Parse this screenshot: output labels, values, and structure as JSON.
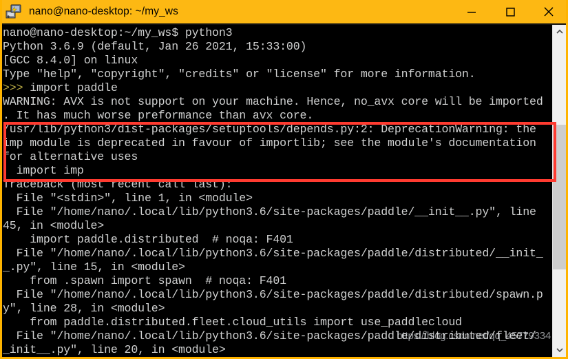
{
  "window": {
    "title": "nano@nano-desktop: ~/my_ws",
    "icon": "terminal-icon",
    "titlebar_color": "#FDB813",
    "border_color": "#FFB400",
    "background_color": "#000000",
    "text_color": "#cfd0d0",
    "controls": {
      "minimize_label": "Minimize",
      "maximize_label": "Maximize",
      "close_label": "Close"
    }
  },
  "terminal": {
    "lines": [
      "nano@nano-desktop:~/my_ws$ python3",
      "Python 3.6.9 (default, Jan 26 2021, 15:33:00)",
      "[GCC 8.4.0] on linux",
      "Type \"help\", \"copyright\", \"credits\" or \"license\" for more information.",
      ">>> import paddle",
      "WARNING: AVX is not support on your machine. Hence, no_avx core will be imported",
      ". It has much worse preformance than avx core.",
      "/usr/lib/python3/dist-packages/setuptools/depends.py:2: DeprecationWarning: the",
      "imp module is deprecated in favour of importlib; see the module's documentation",
      "for alternative uses",
      "  import imp",
      "Traceback (most recent call last):",
      "  File \"<stdin>\", line 1, in <module>",
      "  File \"/home/nano/.local/lib/python3.6/site-packages/paddle/__init__.py\", line",
      "45, in <module>",
      "    import paddle.distributed  # noqa: F401",
      "  File \"/home/nano/.local/lib/python3.6/site-packages/paddle/distributed/__init_",
      "_.py\", line 15, in <module>",
      "    from .spawn import spawn  # noqa: F401",
      "  File \"/home/nano/.local/lib/python3.6/site-packages/paddle/distributed/spawn.p",
      "y\", line 28, in <module>",
      "    from paddle.distributed.fleet.cloud_utils import use_paddlecloud",
      "  File \"/home/nano/.local/lib/python3.6/site-packages/paddle/distributed/fleet/",
      "_init__.py\", line 20, in <module>"
    ],
    "prompt_symbol": ">>>",
    "shell_prompt": "nano@nano-desktop:~/my_ws$",
    "command": "python3"
  },
  "annotation": {
    "highlight_color": "#FF3B30",
    "highlight_label": "DeprecationWarning block highlight",
    "start_line_index": 7,
    "end_line_index": 10
  },
  "watermark": {
    "text": "https://blog.csdn.net/qq_45779334"
  },
  "scrollbar": {
    "up_arrow": "⌃",
    "down_arrow": "⌄",
    "track_color": "#F0F0F0",
    "thumb_color": "#CDCDCD"
  }
}
